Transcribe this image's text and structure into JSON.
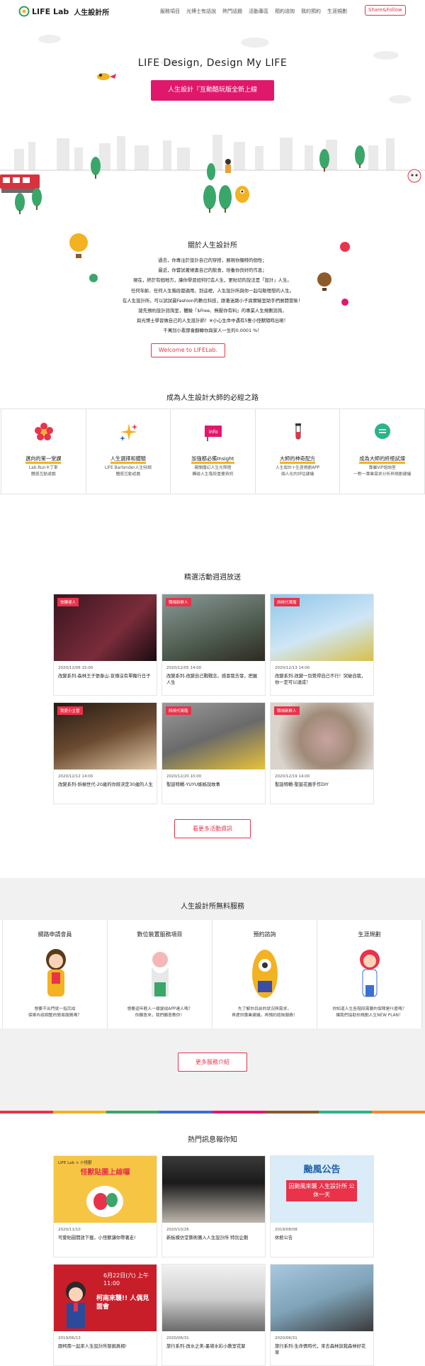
{
  "header": {
    "logo_text": "LIFE Lab",
    "logo_cn": "人生設計所",
    "nav": [
      "服務項目",
      "光博士有話說",
      "熱門話題",
      "活動專區",
      "預約諮詢",
      "我的預約",
      "生涯規劃"
    ],
    "share_label": "Share&Follow"
  },
  "hero": {
    "title": "LIFE Design, Design My LIFE",
    "cta": "人生設計『互動酷玩版全新上線"
  },
  "about": {
    "title": "關於人生設計所",
    "lines": [
      "過去，你專注於設計自己的穿搭，展現你獨特的個性；",
      "最近，你嘗試著規畫自己的飲食，培養你良好的作息；",
      "現在，終於有個地方，讓你學習如何打造人生，更貼切的說法是「設計」人生。",
      "任何年齡、任何人生階段都適用，到這裡，人生設計所與你一起勾勒理想的人生。",
      "在人生設計所，可以試試最Fashion的數位科技，跟著迷路小子與實驗室助手們展開冒險！",
      "搶先預約設計諮詢室，體驗『$Free、無壓你有料』的專業人生規劃諮詢，",
      "與光博士學習做自己的人生設計師！※小心生命中遇有5隻小怪獸隨時出現！",
      "千萬別小看那會翻轉你與家人一生的0.0001 %！"
    ],
    "cta": "Welcome to LIFELab."
  },
  "path": {
    "title": "成為人生設計大師的必經之路",
    "items": [
      {
        "label": "邁向的第一堂課",
        "sub1": "Lab.Run卡丁車",
        "sub2": "體感互動遊戲",
        "icon": "flower-icon"
      },
      {
        "label": "人生選擇和體驗",
        "sub1": "LIFE Bartender人生特調",
        "sub2": "體感互動遊戲",
        "icon": "sparkle-icon"
      },
      {
        "label": "加強都必備Insight",
        "sub1": "親聞魔幻人生光照燈",
        "sub2": "觸碰人生階段重要資訊",
        "icon": "info-flag-icon"
      },
      {
        "label": "大師的神奇配方",
        "sub1": "人生設計+生涯規劃APP",
        "sub2": "個人化的評估建議",
        "icon": "test-tube-icon"
      },
      {
        "label": "成為大師的終極試煉",
        "sub1": "專屬VIP諮詢室",
        "sub2": "一對一專業需求分析與規劃建議",
        "icon": "chat-bubble-icon"
      }
    ]
  },
  "events": {
    "title": "精選活動週週放送",
    "items": [
      {
        "tag": "快轉達人",
        "date": "2020/12/06 15:00",
        "title": "改變系列-森林王子張泰山-宣傳沒有單獨行日子"
      },
      {
        "tag": "職場新鮮人",
        "date": "2020/12/05 14:00",
        "title": "改變系列-改變自己戰戰念，感恩我去發，把握人生"
      },
      {
        "tag": "斜槓代萬階",
        "date": "2020/12/13 14:00",
        "title": "改變系列-改變一別覺得自己不行！突破自我，你一定可以達成！"
      },
      {
        "tag": "我愛小主管",
        "date": "2020/12/12 14:00",
        "title": "改變系列-斜槓世代-20歲的你將決定30歲的人生"
      },
      {
        "tag": "斜槓代萬階",
        "date": "2020/12/20 10:00",
        "title": "聖誕特輯-YUYU姊姊說故事"
      },
      {
        "tag": "職場新鮮人",
        "date": "2020/12/19 14:00",
        "title": "聖誕特輯-聖誕花圈手作DIY"
      }
    ],
    "more": "看更多活動資訊"
  },
  "services": {
    "title": "人生設計所無料服務",
    "items": [
      {
        "title": "網路申請會員",
        "d1": "想要不出門就一指完成",
        "d2": "保單內容調整的簡易服務嗎？"
      },
      {
        "title": "數位裝置服務項目",
        "d1": "想要迴年輕人一樣變成APP達人嗎？",
        "d2": "你願意來，我們願意教你！"
      },
      {
        "title": "預約諮詢",
        "d1": "先了解你目前的狀況與需求，",
        "d2": "再提供專業建議，再預約諮詢服務！"
      },
      {
        "title": "生涯規劃",
        "d1": "你知道人生各階段需要的保障是什麼嗎？",
        "d2": "讓我們協助你規劃人生NEW PLAN！"
      }
    ],
    "more": "更多服務介紹"
  },
  "news": {
    "title": "熱門訊息報你知",
    "items": [
      {
        "date": "2020/11/10",
        "title": "可愛貼圖開放下載，小怪獸讓你帶著走!",
        "poster1": "怪獸貼圖上線囉",
        "poster2": "LIFE Lab × 小怪獸"
      },
      {
        "date": "2020/10/26",
        "title": "新板模仿堂藝術團入人生設計所 特別企劃",
        "poster1": "",
        "poster2": ""
      },
      {
        "date": "2019/08/08",
        "title": "休館公告",
        "poster1": "颱風公告",
        "poster2": "因颱風來襲 人生設計所 公休一天"
      },
      {
        "date": "2019/06/13",
        "title": "跟柯南一起來人生設計所發掘真相!",
        "poster1": "柯南來襲!! 人偶見面會",
        "poster2": "6月22日(六) 上午11:00"
      },
      {
        "date": "2020/06/31",
        "title": "旅行系列-改水之美-墨堪水彩小教室花絮",
        "poster1": "",
        "poster2": ""
      },
      {
        "date": "2020/06/31",
        "title": "旅行系列-生命情時代，來去森林說我森林好花草",
        "poster1": "",
        "poster2": ""
      }
    ]
  },
  "colors": {
    "accent": "#e8334a",
    "hero_button": "#e0186c",
    "underline": "#f3b222"
  }
}
